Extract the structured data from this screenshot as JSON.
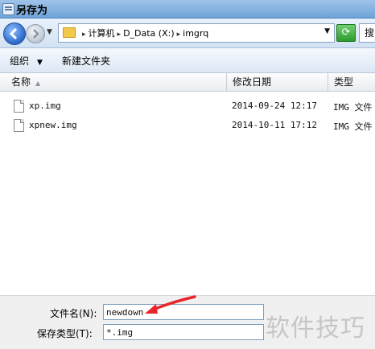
{
  "window": {
    "title": "另存为"
  },
  "address": {
    "path": [
      "计算机",
      "D_Data (X:)",
      "imgrq"
    ],
    "search_partial": "搜"
  },
  "toolbar": {
    "organize": "组织",
    "new_folder": "新建文件夹"
  },
  "columns": {
    "name": "名称",
    "date": "修改日期",
    "type": "类型"
  },
  "files": [
    {
      "name": "xp.img",
      "date": "2014-09-24 12:17",
      "type": "IMG 文件"
    },
    {
      "name": "xpnew.img",
      "date": "2014-10-11 17:12",
      "type": "IMG 文件"
    }
  ],
  "save": {
    "filename_label": "文件名(N):",
    "filename_value": "newdown",
    "savetype_label": "保存类型(T):",
    "savetype_value": "*.img"
  },
  "watermark": "软件技巧",
  "colors": {
    "annotation_arrow": "#e8262b",
    "title_bar": "#7fb0e0"
  }
}
